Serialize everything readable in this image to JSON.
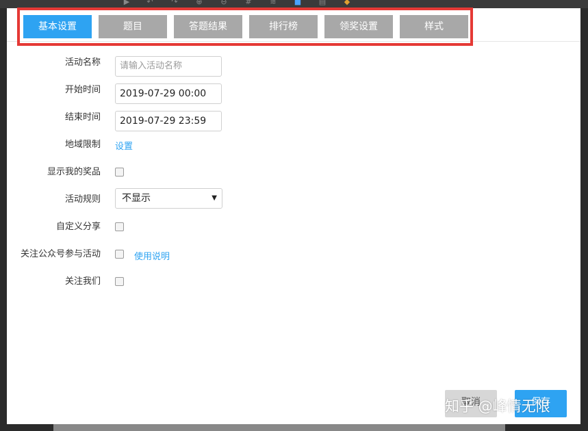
{
  "tabs": [
    {
      "label": "基本设置"
    },
    {
      "label": "题目"
    },
    {
      "label": "答题结果"
    },
    {
      "label": "排行榜"
    },
    {
      "label": "领奖设置"
    },
    {
      "label": "样式"
    }
  ],
  "form": {
    "activity_name": {
      "label": "活动名称",
      "placeholder": "请输入活动名称"
    },
    "start_time": {
      "label": "开始时间",
      "value": "2019-07-29 00:00"
    },
    "end_time": {
      "label": "结束时间",
      "value": "2019-07-29 23:59"
    },
    "region": {
      "label": "地域限制",
      "link": "设置"
    },
    "show_prizes": {
      "label": "显示我的奖品"
    },
    "rules": {
      "label": "活动规则",
      "selected": "不显示"
    },
    "custom_share": {
      "label": "自定义分享"
    },
    "follow_account": {
      "label": "关注公众号参与活动",
      "link": "使用说明"
    },
    "follow_us": {
      "label": "关注我们"
    }
  },
  "buttons": {
    "cancel": "取消",
    "save": "保存"
  },
  "watermark": "知乎 @峰情无限",
  "colors": {
    "accent": "#2ea3f2",
    "tab_inactive": "#a8a8a8",
    "highlight": "#e53935"
  }
}
